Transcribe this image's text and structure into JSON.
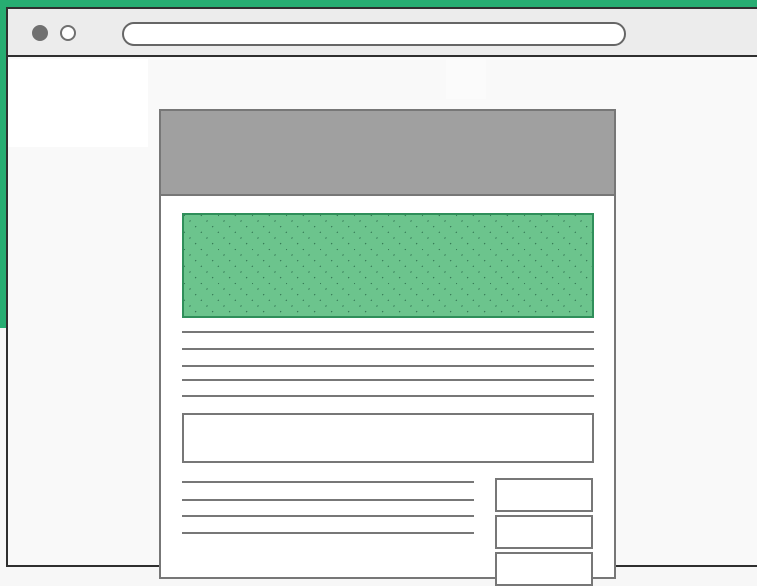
{
  "browser": {
    "window_controls": [
      "close-dot",
      "minimize-dot"
    ],
    "address_bar": ""
  },
  "page": {
    "header": "",
    "hero": "",
    "text_lines": 5,
    "input_box": "",
    "side_buttons": 3
  },
  "colors": {
    "accent": "#27ad72",
    "hero_fill": "#6cc48d",
    "hero_border": "#2f8f5a",
    "header_gray": "#a0a0a0",
    "line_gray": "#777777",
    "window_outline": "#2f2f2f"
  }
}
